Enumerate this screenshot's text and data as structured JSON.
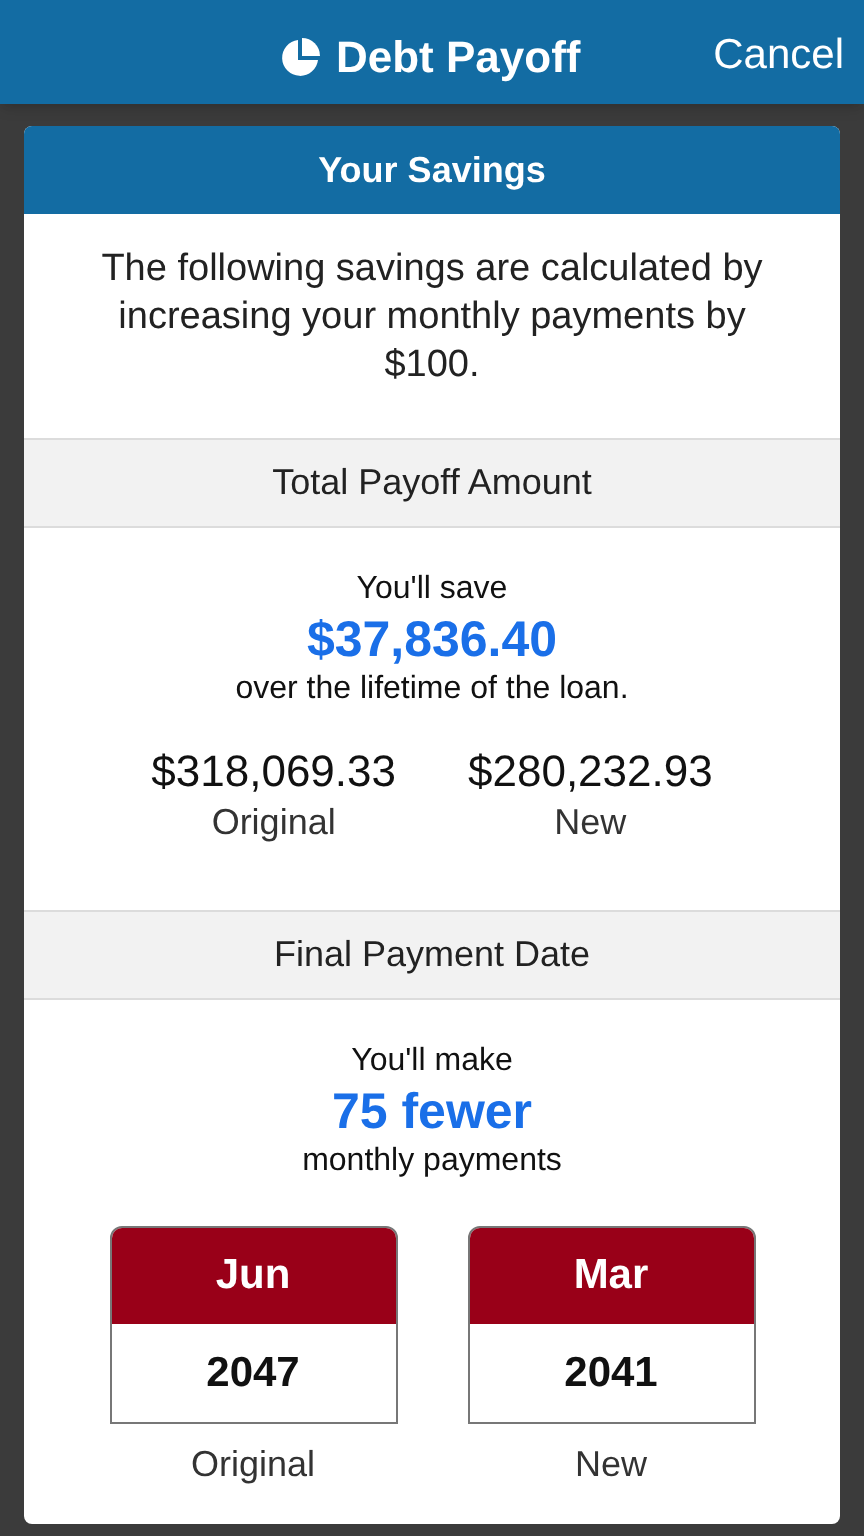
{
  "app_bar": {
    "title": "Debt Payoff",
    "cancel": "Cancel"
  },
  "card": {
    "title": "Your Savings",
    "intro": "The following savings are calculated by increasing your monthly payments by $100.",
    "sections": [
      {
        "kind": "amount",
        "heading": "Total Payoff Amount",
        "lead": "You'll save",
        "highlight": "$37,836.40",
        "trail": "over the lifetime of the loan.",
        "items": [
          {
            "value": "$318,069.33",
            "label": "Original"
          },
          {
            "value": "$280,232.93",
            "label": "New"
          }
        ]
      },
      {
        "kind": "date",
        "heading": "Final Payment Date",
        "lead": "You'll make",
        "highlight": "75 fewer",
        "trail": "monthly payments",
        "items": [
          {
            "month": "Jun",
            "year": "2047",
            "label": "Original"
          },
          {
            "month": "Mar",
            "year": "2041",
            "label": "New"
          }
        ]
      }
    ]
  }
}
